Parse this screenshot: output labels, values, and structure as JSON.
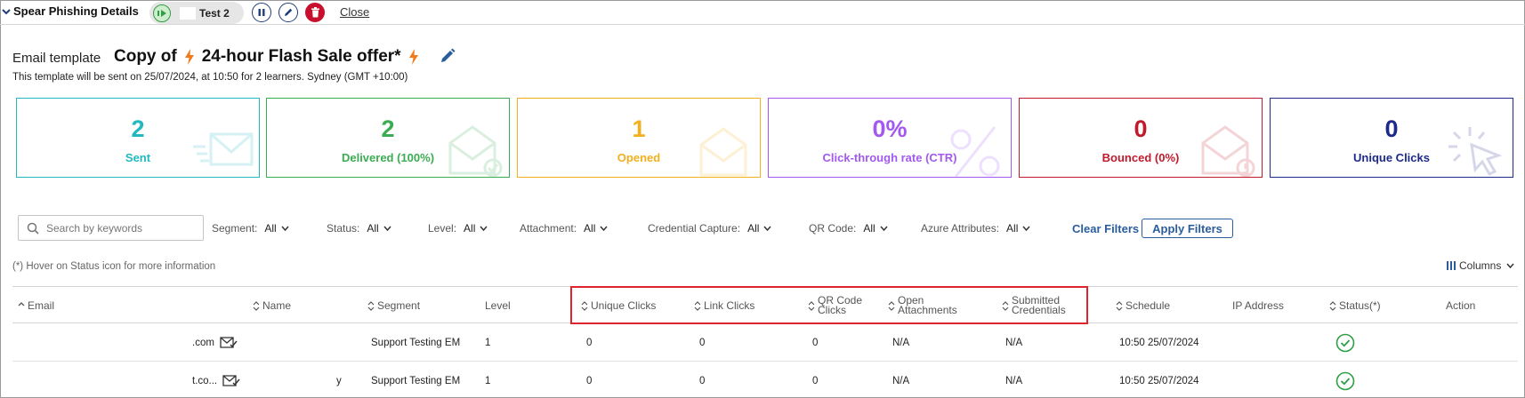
{
  "header": {
    "section_title": "Spear Phishing Details",
    "campaign_name": "Test 2",
    "close_label": "Close"
  },
  "template": {
    "label": "Email template",
    "title_prefix": "Copy of",
    "title": "24-hour Flash Sale offer*",
    "subtitle": "This template will be sent on 25/07/2024, at 10:50 for 2 learners. Sydney (GMT +10:00)"
  },
  "stats": [
    {
      "value": "2",
      "label": "Sent",
      "color": "#22b8c0"
    },
    {
      "value": "2",
      "label": "Delivered (100%)",
      "color": "#3aad52"
    },
    {
      "value": "1",
      "label": "Opened",
      "color": "#f2b01e"
    },
    {
      "value": "0%",
      "label": "Click-through rate (CTR)",
      "color": "#a259f0"
    },
    {
      "value": "0",
      "label": "Bounced (0%)",
      "color": "#c01b2c"
    },
    {
      "value": "0",
      "label": "Unique Clicks",
      "color": "#1e2a8a"
    }
  ],
  "filters": {
    "search_placeholder": "Search by keywords",
    "items": [
      {
        "label": "Segment:",
        "value": "All"
      },
      {
        "label": "Status:",
        "value": "All"
      },
      {
        "label": "Level:",
        "value": "All"
      },
      {
        "label": "Attachment:",
        "value": "All"
      },
      {
        "label": "Credential Capture:",
        "value": "All"
      },
      {
        "label": "QR Code:",
        "value": "All"
      },
      {
        "label": "Azure Attributes:",
        "value": "All"
      }
    ],
    "clear_label": "Clear Filters",
    "apply_label": "Apply Filters"
  },
  "hover_note": "(*) Hover on Status icon for more information",
  "columns_label": "Columns",
  "table": {
    "columns": [
      "Email",
      "Name",
      "Segment",
      "Level",
      "Unique Clicks",
      "Link Clicks",
      "QR Code Clicks",
      "Open Attachments",
      "Submitted Credentials",
      "Schedule",
      "IP Address",
      "Status(*)",
      "Action"
    ],
    "rows": [
      {
        "email": ".com",
        "name": "",
        "segment": "Support Testing EM",
        "level": "1",
        "unique_clicks": "0",
        "link_clicks": "0",
        "qr_clicks": "0",
        "open_attachments": "N/A",
        "submitted_credentials": "N/A",
        "schedule": "10:50 25/07/2024",
        "ip": "",
        "action": ""
      },
      {
        "email": "t.co...",
        "name": "y",
        "segment": "Support Testing EM",
        "level": "1",
        "unique_clicks": "0",
        "link_clicks": "0",
        "qr_clicks": "0",
        "open_attachments": "N/A",
        "submitted_credentials": "N/A",
        "schedule": "10:50 25/07/2024",
        "ip": "",
        "action": ""
      }
    ]
  },
  "icons": {
    "collapse": "chevron-down-icon",
    "play": "play-icon",
    "pause": "pause-icon",
    "edit": "pencil-icon",
    "delete": "trash-icon",
    "search": "search-icon",
    "sort": "sort-icon",
    "status": "check-circle-icon",
    "mail": "mail-check-icon"
  }
}
